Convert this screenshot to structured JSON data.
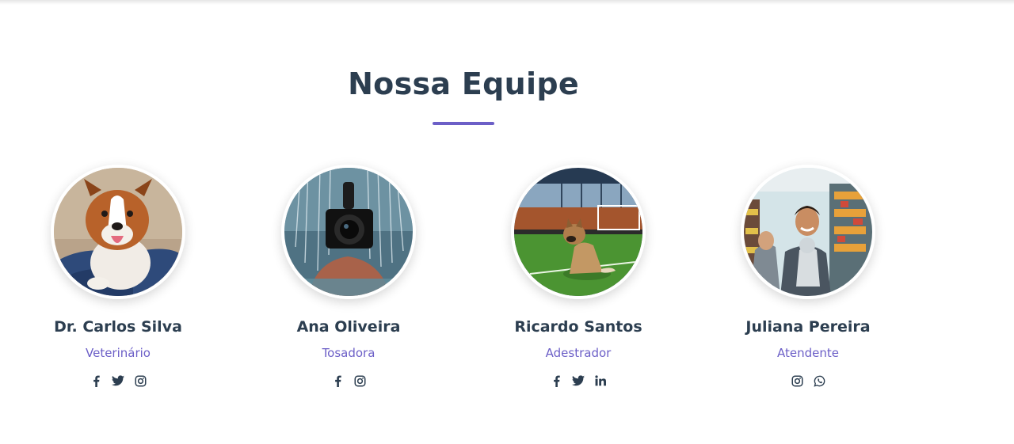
{
  "section": {
    "title": "Nossa Equipe"
  },
  "colors": {
    "heading": "#2c3e50",
    "accent": "#6c5fc7"
  },
  "team": [
    {
      "name": "Dr. Carlos Silva",
      "role": "Veterinário",
      "photo": "dog-on-blue-sofa-photo",
      "socials": [
        "facebook-icon",
        "twitter-icon",
        "instagram-icon"
      ]
    },
    {
      "name": "Ana Oliveira",
      "role": "Tosadora",
      "photo": "camera-under-shower-photo",
      "socials": [
        "facebook-icon",
        "instagram-icon"
      ]
    },
    {
      "name": "Ricardo Santos",
      "role": "Adestrador",
      "photo": "dog-on-football-field-photo",
      "socials": [
        "facebook-icon",
        "twitter-icon",
        "linkedin-icon"
      ]
    },
    {
      "name": "Juliana Pereira",
      "role": "Atendente",
      "photo": "people-with-dog-in-pet-shop-photo",
      "socials": [
        "instagram-icon",
        "whatsapp-icon"
      ]
    }
  ]
}
